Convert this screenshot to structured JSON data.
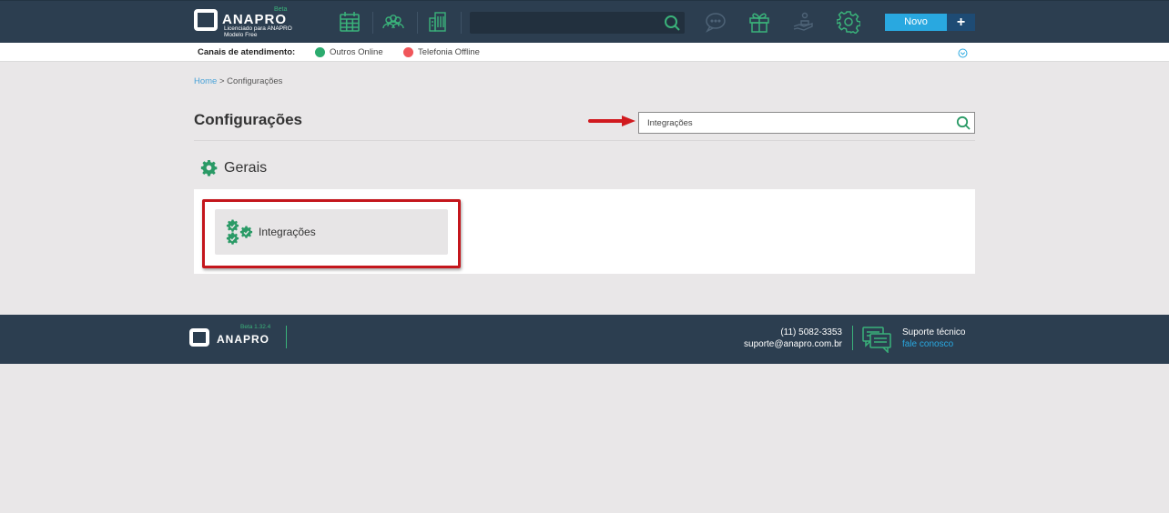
{
  "header": {
    "brand": "ANAPRO",
    "beta": "Beta",
    "license_line1": "Licenciado para ANAPRO",
    "license_line2": "Modelo Free",
    "search_value": "",
    "new_button_label": "Novo",
    "plus_label": "+"
  },
  "channels": {
    "label": "Canais de atendimento:",
    "items": [
      {
        "label": "Outros Online",
        "color": "#2bab6e"
      },
      {
        "label": "Telefonia Offline",
        "color": "#f0565a"
      }
    ]
  },
  "breadcrumb": {
    "home": "Home",
    "separator": " > ",
    "current": "Configurações"
  },
  "page": {
    "title": "Configurações",
    "search_value": "Integrações"
  },
  "section": {
    "title": "Gerais"
  },
  "cards": [
    {
      "label": "Integrações",
      "icon": "gears-check-icon"
    }
  ],
  "footer": {
    "brand": "ANAPRO",
    "version": "Beta 1.32.4",
    "phone": "(11) 5082-3353",
    "email": "suporte@anapro.com.br",
    "support_title": "Suporte técnico",
    "support_link": "fale conosco"
  },
  "colors": {
    "header_bg": "#2c3e50",
    "accent_green": "#3ab27a",
    "accent_blue": "#29a8e0",
    "highlight_red": "#c4161c",
    "page_bg": "#e9e7e8"
  }
}
